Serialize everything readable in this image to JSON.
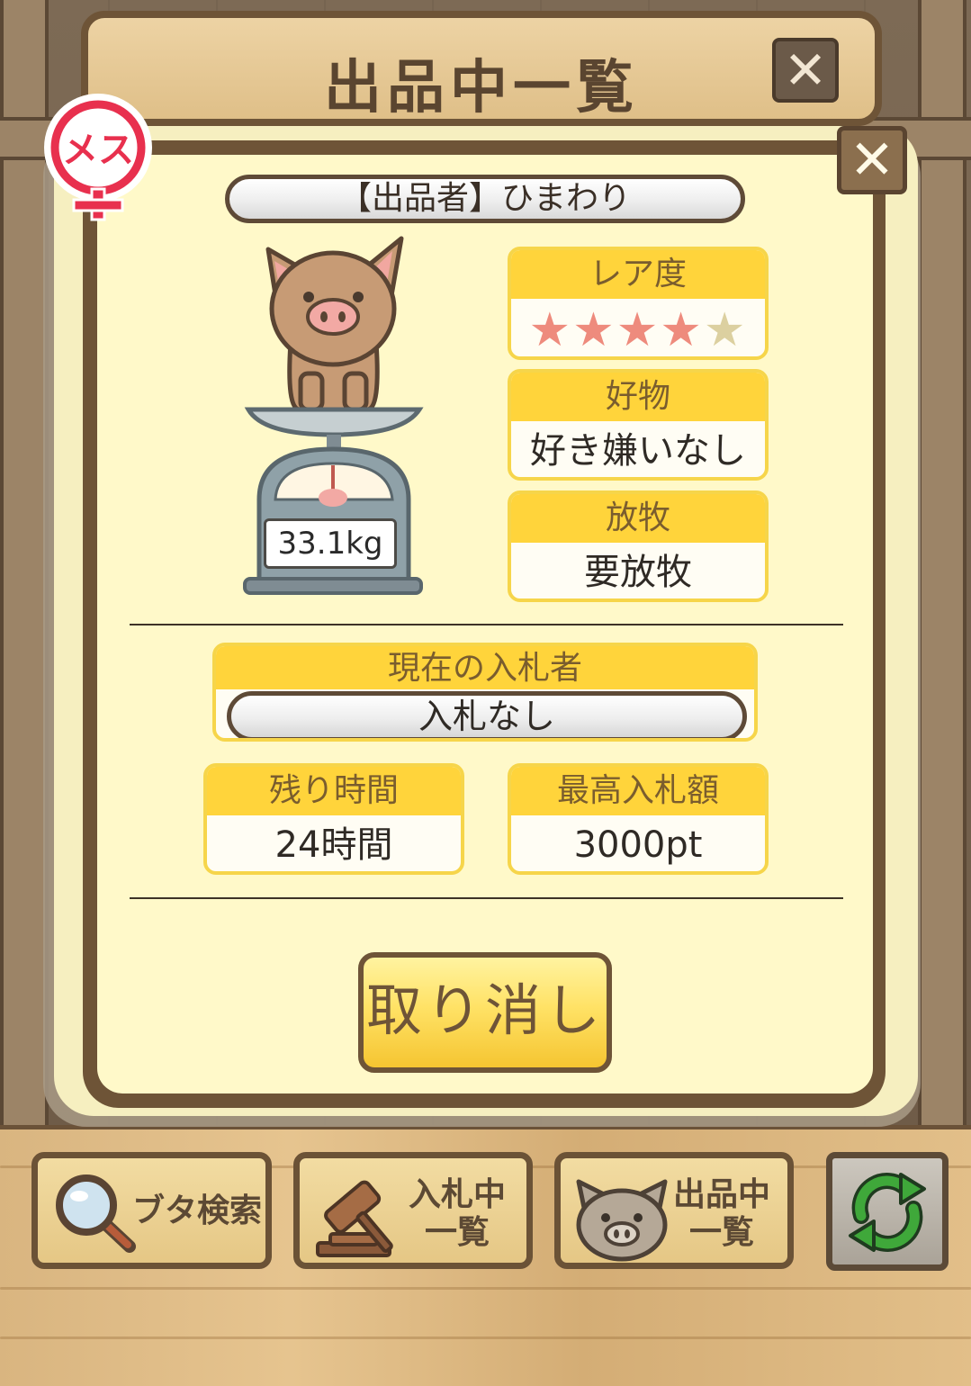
{
  "header": {
    "title": "出品中一覧",
    "close_label": "✕"
  },
  "modal": {
    "close_label": "✕",
    "gender_badge": "メス",
    "seller": "【出品者】ひまわり",
    "weight": "33.1kg",
    "rarity": {
      "label": "レア度",
      "stars_on": "★★★★",
      "stars_off": "★",
      "value": 4,
      "max": 5
    },
    "favorite": {
      "label": "好物",
      "value": "好き嫌いなし"
    },
    "pasture": {
      "label": "放牧",
      "value": "要放牧"
    },
    "current_bidder": {
      "label": "現在の入札者",
      "value": "入札なし"
    },
    "remaining_time": {
      "label": "残り時間",
      "value": "24時間"
    },
    "max_bid": {
      "label": "最高入札額",
      "value": "3000pt"
    },
    "cancel_button": "取り消し"
  },
  "toolbar": {
    "search": "ブタ検索",
    "bidding_line1": "入札中",
    "bidding_line2": "一覧",
    "listing_line1": "出品中",
    "listing_line2": "一覧"
  },
  "colors": {
    "panel_bg": "#fff9c9",
    "frame_brown": "#6e5437",
    "header_yellow": "#ffd43b",
    "star_on": "#ee8b7d",
    "button_yellow": "#ffe266"
  },
  "icons": [
    "pig-on-scale-icon",
    "magnifier-icon",
    "gavel-icon",
    "pig-face-icon",
    "refresh-icon",
    "female-icon",
    "close-icon"
  ]
}
